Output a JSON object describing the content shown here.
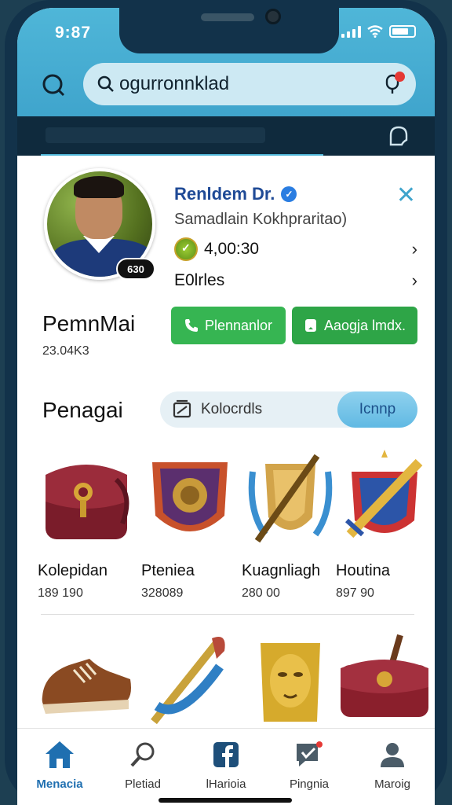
{
  "status_bar": {
    "time": "9:87"
  },
  "search": {
    "query": "ogurronnklad"
  },
  "profile": {
    "name": "Renldem Dr.",
    "subtitle": "Samadlain Kokhpraritao)",
    "coins": "4,00:30",
    "link_label": "E0lrles",
    "avatar_badge": "630",
    "display_name": "PemnMai",
    "display_sub": "23.04K3"
  },
  "actions": {
    "primary_label": "Plennanlor",
    "secondary_label": "Aaogja lmdx."
  },
  "section": {
    "title": "Penagai",
    "filter_label": "Kolocrdls",
    "active_filter": "Icnnp"
  },
  "items": [
    {
      "name": "Kolepidan",
      "price": "189 190",
      "icon": "satchel-icon"
    },
    {
      "name": "Pteniea",
      "price": "328089",
      "icon": "shield-icon"
    },
    {
      "name": "Kuagnliagh",
      "price": "280 00",
      "icon": "crest-sword-icon"
    },
    {
      "name": "Houtina",
      "price": "897 90",
      "icon": "emblem-icon"
    }
  ],
  "items_row2": [
    {
      "icon": "sneaker-icon"
    },
    {
      "icon": "sword-icon"
    },
    {
      "icon": "golden-mask-icon"
    },
    {
      "icon": "bag-icon"
    }
  ],
  "nav": [
    {
      "label": "Menacia",
      "icon": "home-icon",
      "active": true
    },
    {
      "label": "Pletiad",
      "icon": "search-icon"
    },
    {
      "label": "lHarioia",
      "icon": "facebook-icon"
    },
    {
      "label": "Pingnia",
      "icon": "chat-icon"
    },
    {
      "label": "Maroig",
      "icon": "profile-icon"
    }
  ],
  "colors": {
    "accent_blue": "#3fa4cc",
    "green": "#36b552",
    "name_blue": "#1f4a96"
  }
}
